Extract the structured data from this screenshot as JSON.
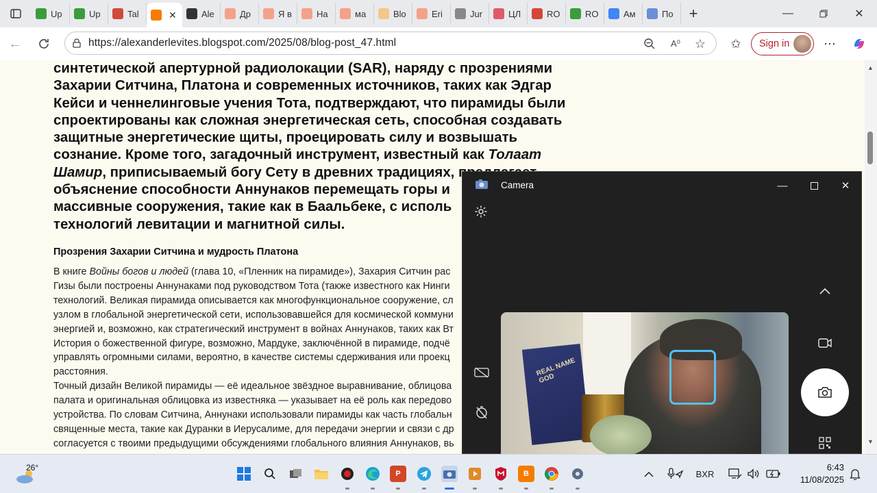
{
  "browser": {
    "tabs": [
      {
        "label": "Up",
        "favicon": "play-icon",
        "color": "#3a9d3a"
      },
      {
        "label": "Up",
        "favicon": "play-icon",
        "color": "#3a9d3a"
      },
      {
        "label": "Tal",
        "favicon": "pdf-icon",
        "color": "#d04a3a"
      },
      {
        "label": "",
        "favicon": "blogger-icon",
        "color": "#f57c00",
        "active": true
      },
      {
        "label": "Ale",
        "favicon": "x-icon",
        "color": "#333333"
      },
      {
        "label": "Др",
        "favicon": "blogger-icon",
        "color": "#f4a18a"
      },
      {
        "label": "Я в",
        "favicon": "blogger-icon",
        "color": "#f4a18a"
      },
      {
        "label": "На",
        "favicon": "blogger-icon",
        "color": "#f4a18a"
      },
      {
        "label": "ма",
        "favicon": "blogger-icon",
        "color": "#f4a18a"
      },
      {
        "label": "Blo",
        "favicon": "blogger-icon",
        "color": "#f3c78a"
      },
      {
        "label": "Eri",
        "favicon": "blogger-icon",
        "color": "#f4a18a"
      },
      {
        "label": "Jur",
        "favicon": "wikipedia-icon",
        "color": "#888888"
      },
      {
        "label": "ЦЛ",
        "favicon": "diamond-icon",
        "color": "#e05a6a"
      },
      {
        "label": "RO",
        "favicon": "gmail-icon",
        "color": "#d44638"
      },
      {
        "label": "RO",
        "favicon": "play-icon",
        "color": "#3a9d3a"
      },
      {
        "label": "Ам",
        "favicon": "google-icon",
        "color": "#4285f4"
      },
      {
        "label": "По",
        "favicon": "help-icon",
        "color": "#6b8fd6"
      }
    ],
    "active_tab_close": "✕",
    "new_tab": "+",
    "url": "https://alexanderlevites.blogspot.com/2025/08/blog-post_47.html",
    "sign_in": "Sign in"
  },
  "article": {
    "bold_lines": [
      "синтетической апертурной радиолокации (SAR), наряду с прозрениями",
      "Захарии Ситчина, Платона и современных источников, таких как Эдгар",
      "Кейси и ченнелинговые учения Тота, подтверждают, что пирамиды были",
      "спроектированы как сложная энергетическая сеть, способная создавать",
      "защитные энергетические щиты, проецировать силу и возвышать"
    ],
    "bold_line6_a": "сознание. Кроме того, загадочный инструмент, известный как ",
    "bold_line6_em": "Толаат",
    "bold_line7_em": "Шамир",
    "bold_line7_b": ", приписываемый богу Сету в древних традициях, предлагает",
    "bold_lines_rest": [
      "объяснение способности Аннунаков перемещать горы и",
      "массивные сооружения, такие как в Баальбеке, с исполь",
      "технологий левитации и магнитной силы."
    ],
    "section_title": "Прозрения Захарии Ситчина и мудрость Платона",
    "body_line1_a": "В книге ",
    "body_line1_em": "Войны богов и людей",
    "body_line1_b": " (глава 10, «Пленник на пирамиде»), Захария Ситчин рас",
    "body_lines": [
      "Гизы были построены Аннунаками под руководством Тота (также известного как Нинги",
      "технологий. Великая пирамида описывается как многофункциональное сооружение, сл",
      "узлом в глобальной энергетической сети, использовавшейся для космической коммуни",
      "энергией и, возможно, как стратегический инструмент в войнах Аннунаков, таких как Вт",
      "История о божественной фигуре, возможно, Мардуке, заключённой в пирамиде, подчё",
      "управлять огромными силами, вероятно, в качестве системы сдерживания или проекц",
      "расстояния.",
      "Точный дизайн Великой пирамиды — её идеальное звёздное выравнивание, облицова",
      "палата и оригинальная облицовка из известняка — указывает на её роль как передово",
      "устройства. По словам Ситчина, Аннунаки использовали пирамиды как часть глобальн",
      "священные места, такие как Дуранки в Иерусалиме, для передачи энергии и связи с др",
      "согласуется с твоими предыдущими обсуждениями глобального влияния Аннунаков, вь"
    ]
  },
  "camera": {
    "title": "Camera",
    "book_text": "REAL NAME GOD"
  },
  "taskbar": {
    "weather_temp": "26°",
    "language": "BXR",
    "time": "6:43",
    "date": "11/08/2025"
  }
}
